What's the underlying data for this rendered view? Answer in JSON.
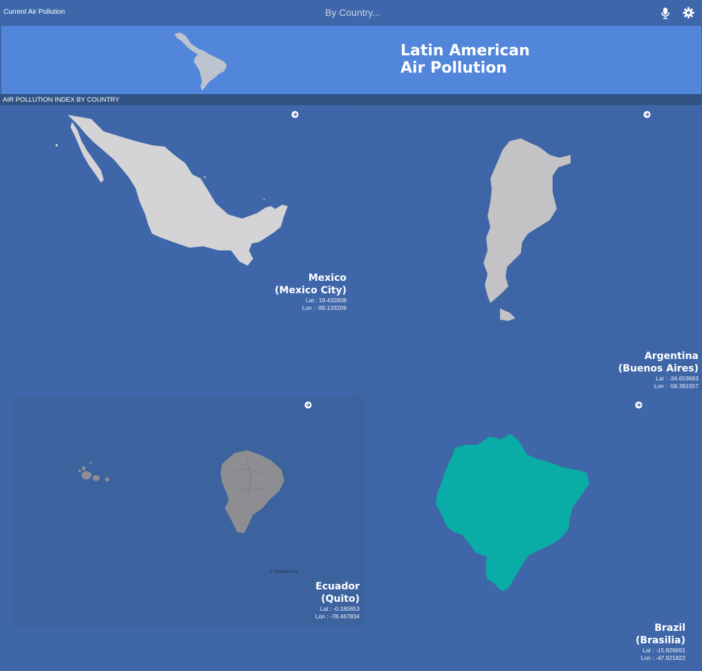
{
  "header": {
    "app_title": "Current Air Pollution",
    "search_placeholder": "By Country...",
    "mic_icon": "microphone-icon",
    "settings_icon": "gear-icon"
  },
  "banner": {
    "title_line1": "Latin American",
    "title_line2": "Air Pollution",
    "map_icon": "latin-america-map"
  },
  "section": {
    "title": "AIR POLLUTION INDEX BY COUNTRY"
  },
  "countries": [
    {
      "name": "Mexico",
      "capital": "(Mexico City)",
      "lat": "Lat : 19.432608",
      "lon": "Lon : -99.133209",
      "map_color": "#d4d4d6"
    },
    {
      "name": "Argentina",
      "capital": "(Buenos Aires)",
      "lat": "Lat : -34.603683",
      "lon": "Lon : -58.381557",
      "map_color": "#c3c3c6"
    },
    {
      "name": "Ecuador",
      "capital": "(Quito)",
      "lat": "Lat : -0.180653",
      "lon": "Lon : -78.467834",
      "map_color": "#8e8e92",
      "credit": "© Vemaps.com"
    },
    {
      "name": "Brazil",
      "capital": "(Brasilia)",
      "lat": "Lat : -15.826691",
      "lon": "Lon : -47.921822",
      "map_color": "#0aaca6"
    }
  ],
  "colors": {
    "topbar": "#3e67ab",
    "banner": "#5186db",
    "section_header": "#315384",
    "card_bg": "#3f66a8"
  }
}
